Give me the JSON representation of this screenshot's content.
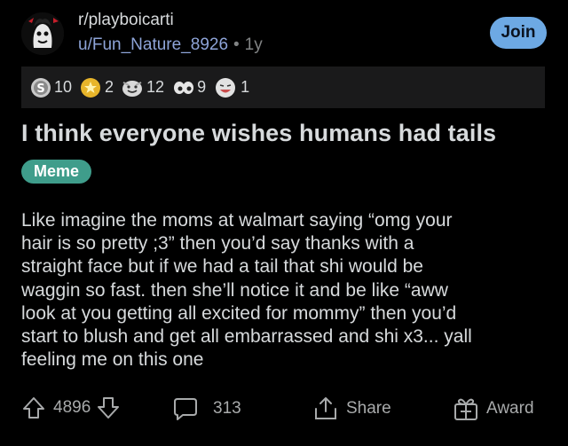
{
  "post": {
    "subreddit": "r/playboicarti",
    "author": "u/Fun_Nature_8926",
    "separator": "•",
    "age": "1y",
    "join_label": "Join",
    "title": "I think everyone wishes humans had tails",
    "flair": "Meme",
    "flair_color": "#3f9d8b",
    "body": "Like imagine the moms at walmart saying “omg your\nhair is so pretty ;3” then you’d say thanks with a\nstraight face but if we had a tail that shi would be\nwaggin so fast. then she’ll notice it and be like “aww\nlook at you getting all excited for mommy” then you’d\nstart to blush and get all embarrassed and shi x3... yall\nfeeling me on this one"
  },
  "awards": [
    {
      "icon": "silver-award-icon",
      "count": "10"
    },
    {
      "icon": "gold-award-icon",
      "count": "2"
    },
    {
      "icon": "wholesome-award-icon",
      "count": "12"
    },
    {
      "icon": "eyes-award-icon",
      "count": "9"
    },
    {
      "icon": "laughing-award-icon",
      "count": "1"
    }
  ],
  "actions": {
    "score": "4896",
    "comments": "313",
    "share_label": "Share",
    "award_label": "Award"
  },
  "colors": {
    "background": "#000000",
    "text": "#d7dadc",
    "username": "#8ea4d8",
    "join_button": "#6da9e4"
  }
}
